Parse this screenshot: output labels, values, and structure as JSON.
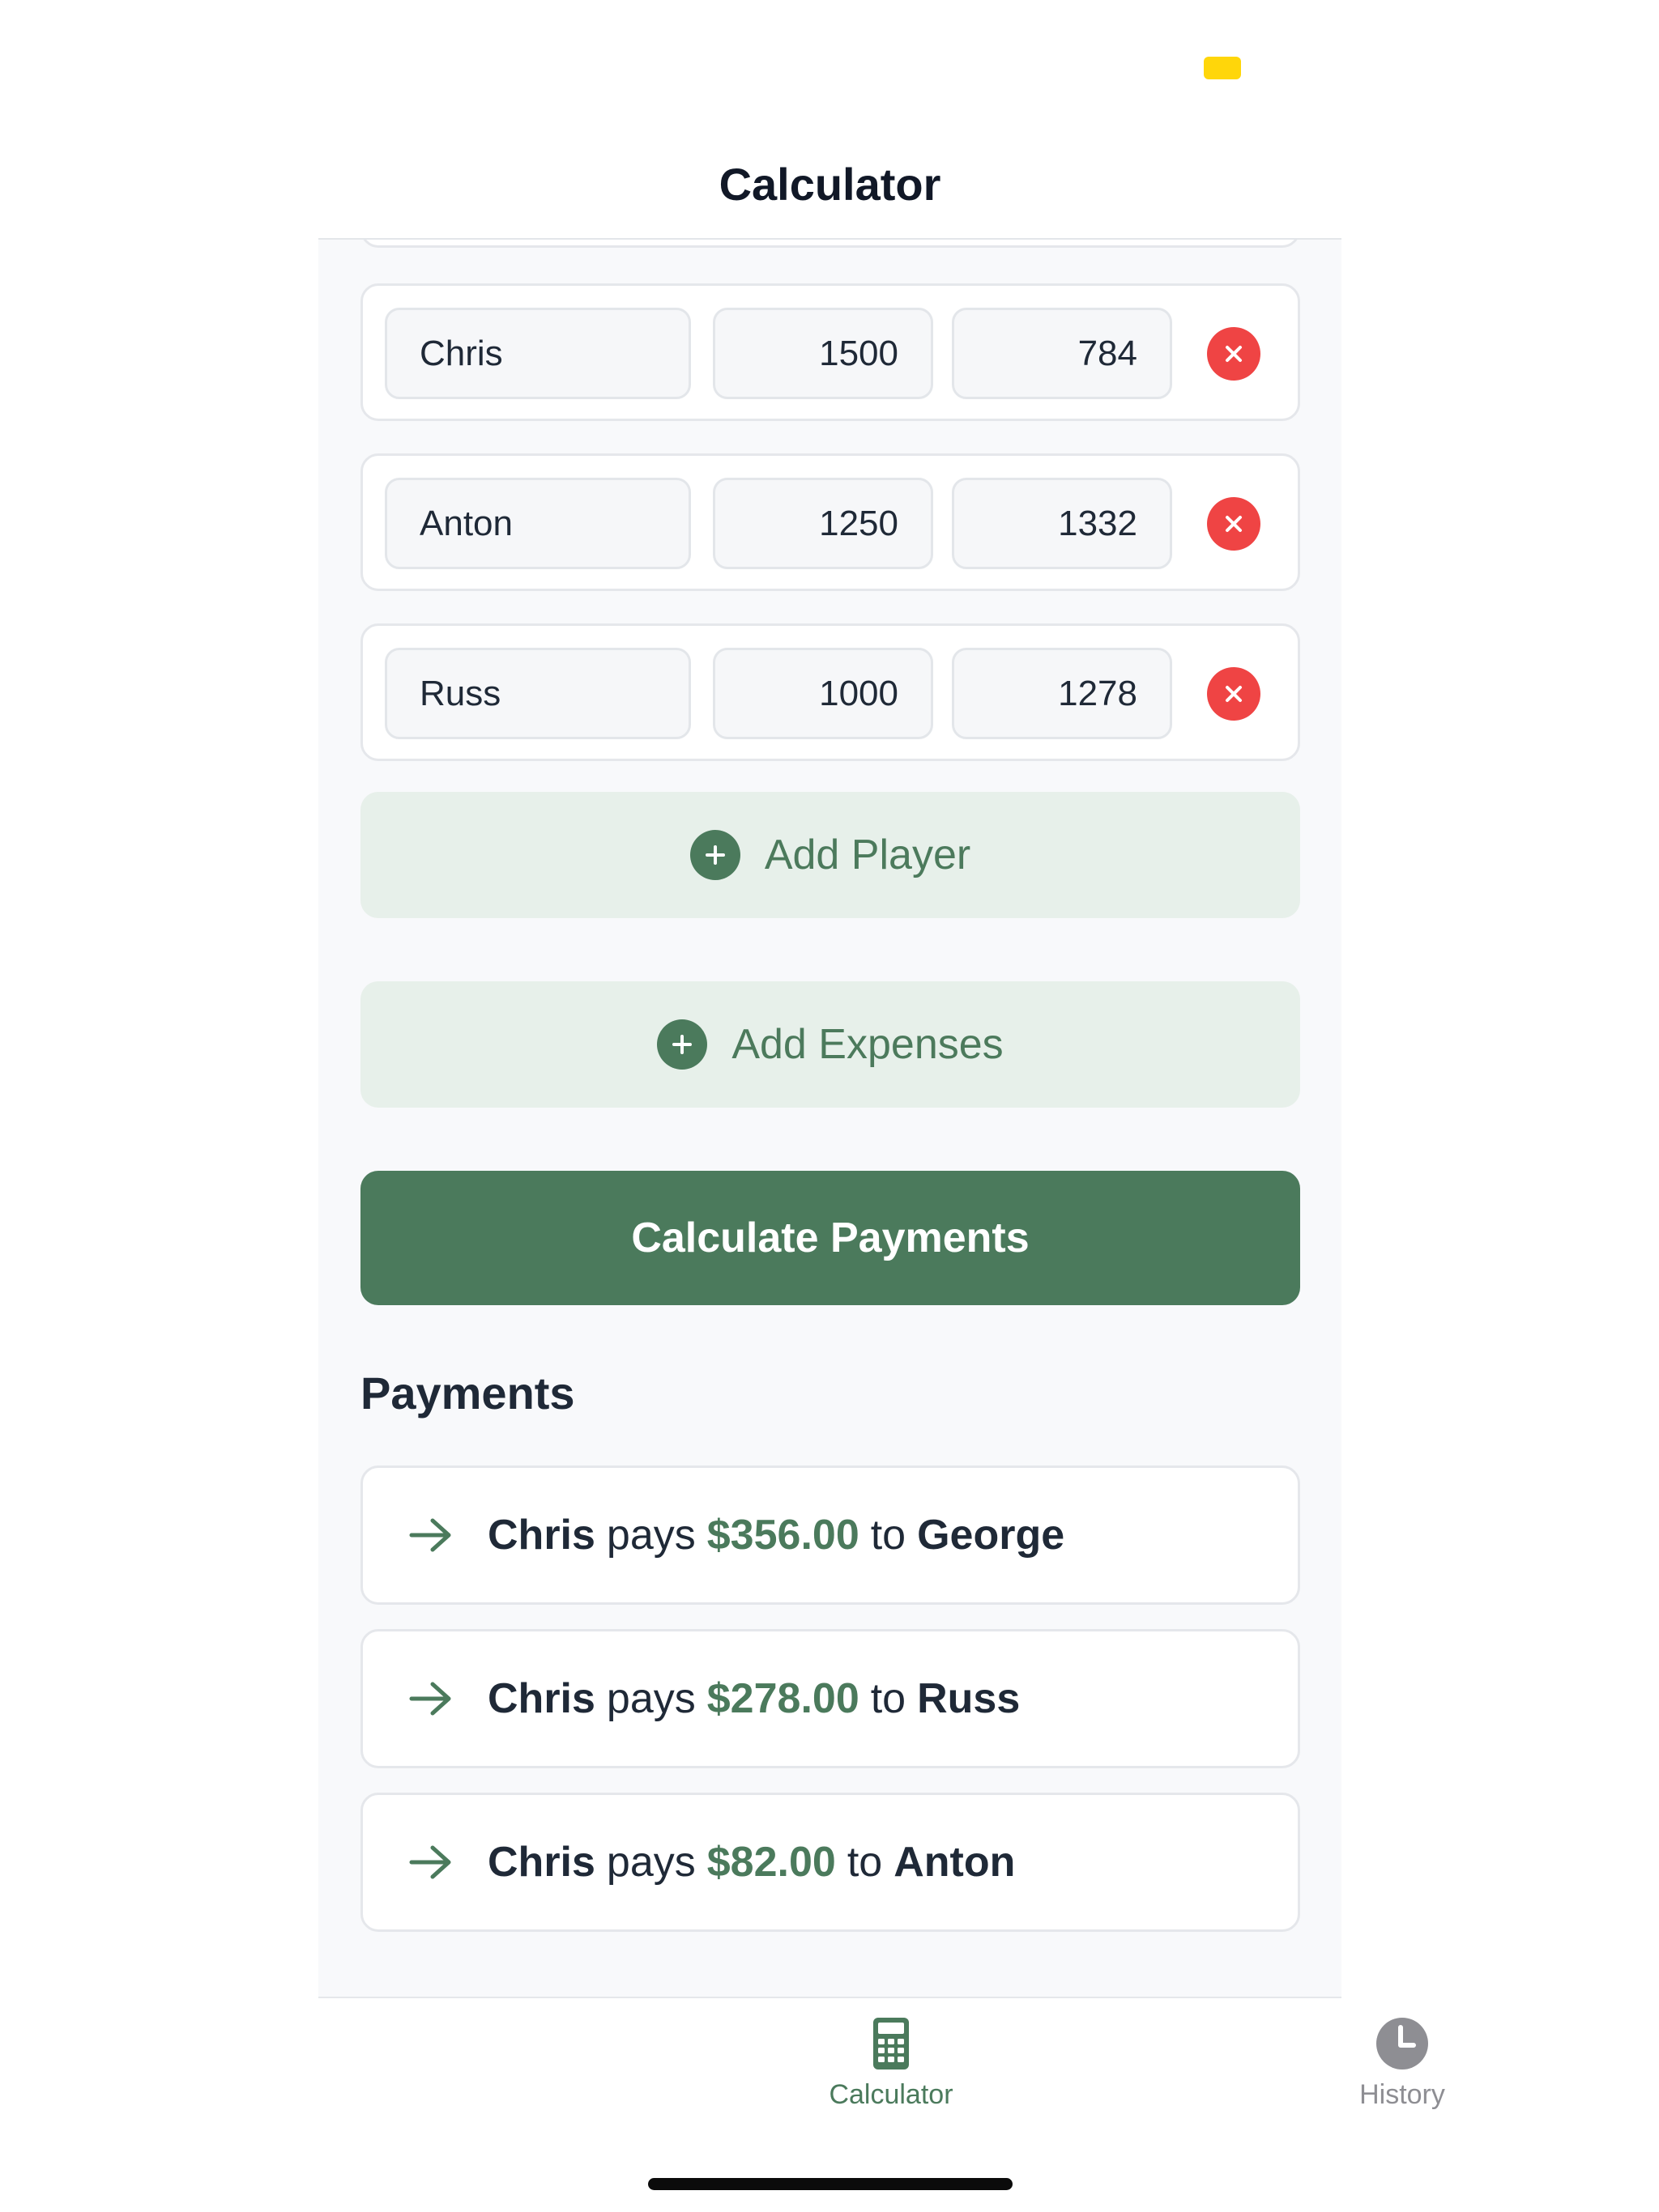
{
  "header": {
    "title": "Calculator"
  },
  "players": [
    {
      "name": "Chris",
      "buy_in": "1500",
      "cash_out": "784"
    },
    {
      "name": "Anton",
      "buy_in": "1250",
      "cash_out": "1332"
    },
    {
      "name": "Russ",
      "buy_in": "1000",
      "cash_out": "1278"
    }
  ],
  "actions": {
    "add_player": "Add Player",
    "add_expenses": "Add Expenses",
    "calculate": "Calculate Payments"
  },
  "payments": {
    "title": "Payments",
    "items": [
      {
        "from": "Chris",
        "verb": "pays",
        "amount": "$356.00",
        "to_word": "to",
        "to": "George"
      },
      {
        "from": "Chris",
        "verb": "pays",
        "amount": "$278.00",
        "to_word": "to",
        "to": "Russ"
      },
      {
        "from": "Chris",
        "verb": "pays",
        "amount": "$82.00",
        "to_word": "to",
        "to": "Anton"
      }
    ]
  },
  "tabbar": {
    "calculator": "Calculator",
    "history": "History"
  },
  "icons": {
    "remove": "close-circle-icon",
    "add": "plus-circle-icon",
    "arrow": "arrow-right-icon",
    "calculator": "calculator-icon",
    "history": "clock-icon"
  },
  "colors": {
    "accent": "#4b7a5c",
    "accent_soft": "#e7f0ea",
    "danger": "#ef4444",
    "status": "#ffd60a"
  }
}
